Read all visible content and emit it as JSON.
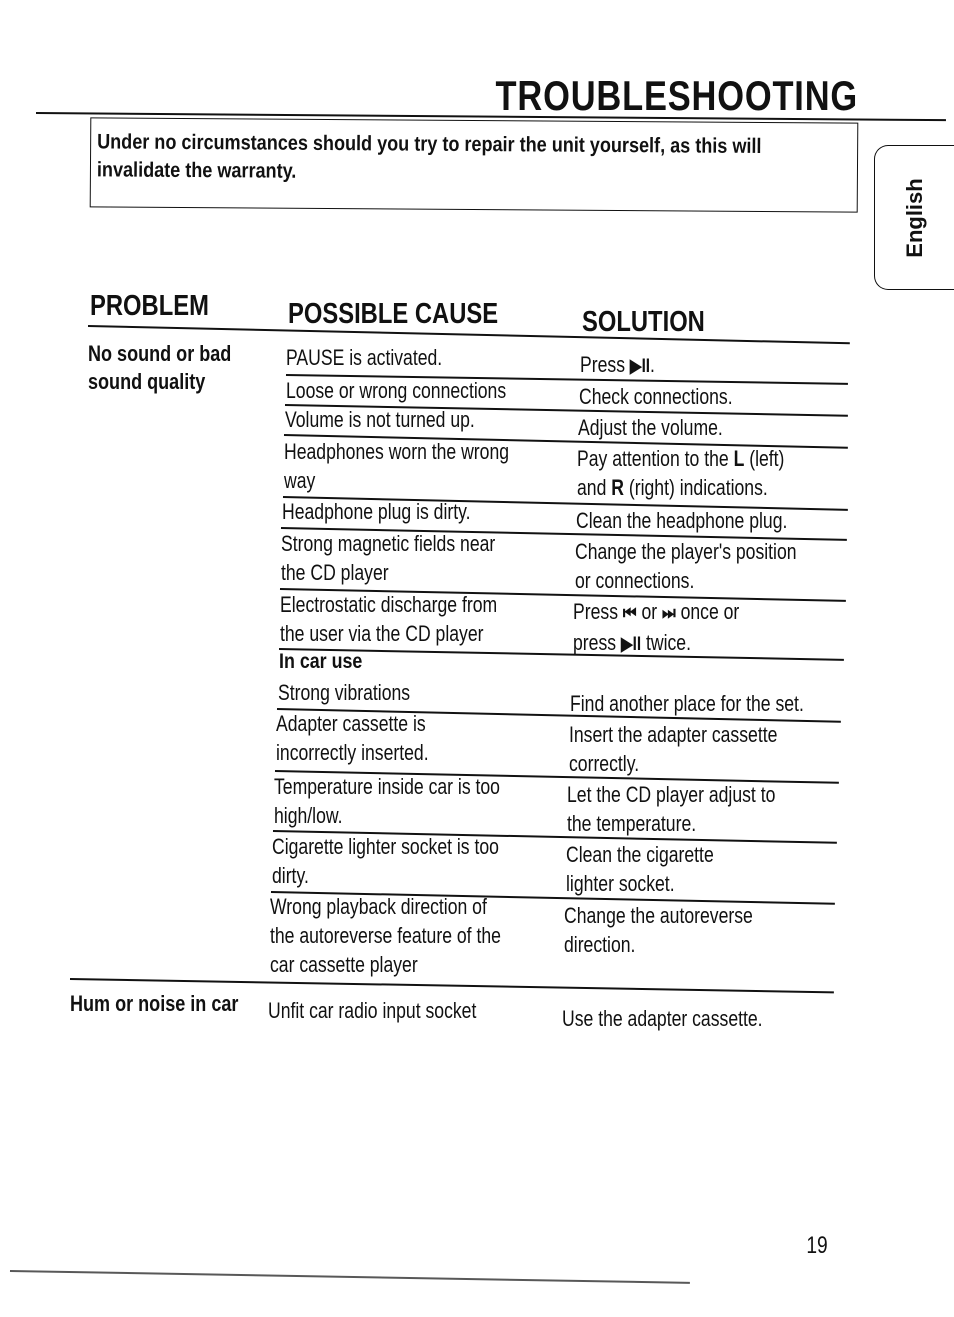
{
  "header": {
    "title": "TROUBLESHOOTING"
  },
  "notice": {
    "text": "Under no circumstances should you try to repair the unit yourself, as this will invalidate the warranty."
  },
  "language_tab": {
    "label": "English"
  },
  "table": {
    "columns": {
      "problem": "PROBLEM",
      "cause": "POSSIBLE CAUSE",
      "solution": "SOLUTION"
    },
    "groups": [
      {
        "problem": "No sound or bad sound quality",
        "rows": [
          {
            "cause": "PAUSE is activated.",
            "solution": "Press ▶II."
          },
          {
            "cause": "Loose or wrong connections",
            "solution": "Check connections."
          },
          {
            "cause": "Volume is not turned up.",
            "solution": "Adjust the volume."
          },
          {
            "cause": "Headphones worn the wrong way",
            "solution": "Pay attention to the L (left) and R (right) indications."
          },
          {
            "cause": "Headphone plug is dirty.",
            "solution": "Clean the headphone plug."
          },
          {
            "cause": "Strong magnetic fields near the CD player",
            "solution": "Change the player's position or connections."
          },
          {
            "cause": "Electrostatic discharge from the user via the CD player",
            "solution": "Press ⏮ or ⏭ once or press ▶II twice."
          }
        ],
        "subsection": {
          "label": "In car use",
          "rows": [
            {
              "cause": "Strong vibrations",
              "solution": "Find another place for the set."
            },
            {
              "cause": "Adapter cassette is incorrectly inserted.",
              "solution": "Insert the adapter cassette correctly."
            },
            {
              "cause": "Temperature inside car is too high/low.",
              "solution": "Let the CD player adjust to the temperature."
            },
            {
              "cause": "Cigarette lighter socket is too dirty.",
              "solution": "Clean the cigarette lighter socket."
            },
            {
              "cause": "Wrong playback direction of the autoreverse feature of the car cassette player",
              "solution": "Change the autoreverse direction."
            }
          ]
        }
      },
      {
        "problem": "Hum or noise in car",
        "rows": [
          {
            "cause": "Unfit car radio input socket",
            "solution": "Use the adapter cassette."
          }
        ]
      }
    ]
  },
  "cells": {
    "r1c": "PAUSE is activated.",
    "r1s_a": "Press ",
    "r1s_sym": "▶II",
    "r1s_b": ".",
    "r2c": "Loose or wrong connections",
    "r2s": "Check connections.",
    "r3c": "Volume is not turned up.",
    "r3s": "Adjust the volume.",
    "r4c1": "Headphones worn the wrong",
    "r4c2": "way",
    "r4s1_a": "Pay attention to the ",
    "r4s1_b": "L",
    "r4s1_c": " (left)",
    "r4s2_a": "and ",
    "r4s2_b": "R",
    "r4s2_c": " (right) indications.",
    "r5c": "Headphone plug is dirty.",
    "r5s": "Clean the headphone plug.",
    "r6c1": "Strong magnetic fields near",
    "r6c2": "the CD player",
    "r6s1": "Change the player's position",
    "r6s2": "or connections.",
    "r7c1": "Electrostatic discharge from",
    "r7c2": "the user via the CD player",
    "r7s1_a": "Press ",
    "r7s1_prev": "⏮",
    "r7s1_b": " or ",
    "r7s1_next": "⏭",
    "r7s1_c": " once or",
    "r7s2_a": "press ",
    "r7s2_sym": "▶II",
    "r7s2_b": " twice.",
    "sub": "In car use",
    "r8c": "Strong vibrations",
    "r8s": "Find another place for the set.",
    "r9c1": "Adapter cassette is",
    "r9c2": "incorrectly inserted.",
    "r9s1": "Insert the adapter cassette",
    "r9s2": "correctly.",
    "r10c1": "Temperature inside car is too",
    "r10c2": "high/low.",
    "r10s1": "Let the CD player adjust to",
    "r10s2": "the temperature.",
    "r11c1": "Cigarette lighter socket is too",
    "r11c2": "dirty.",
    "r11s1": "Clean the cigarette",
    "r11s2": "lighter socket.",
    "r12c1": "Wrong playback direction of",
    "r12c2": "the autoreverse feature of the",
    "r12c3": "car cassette player",
    "r12s1": "Change the autoreverse",
    "r12s2": "direction.",
    "p1l1": "No sound or bad",
    "p1l2": "sound quality",
    "p2": "Hum or noise in car",
    "r13c": "Unfit car radio input socket",
    "r13s": "Use the adapter cassette."
  },
  "footer": {
    "page_number": "19"
  }
}
